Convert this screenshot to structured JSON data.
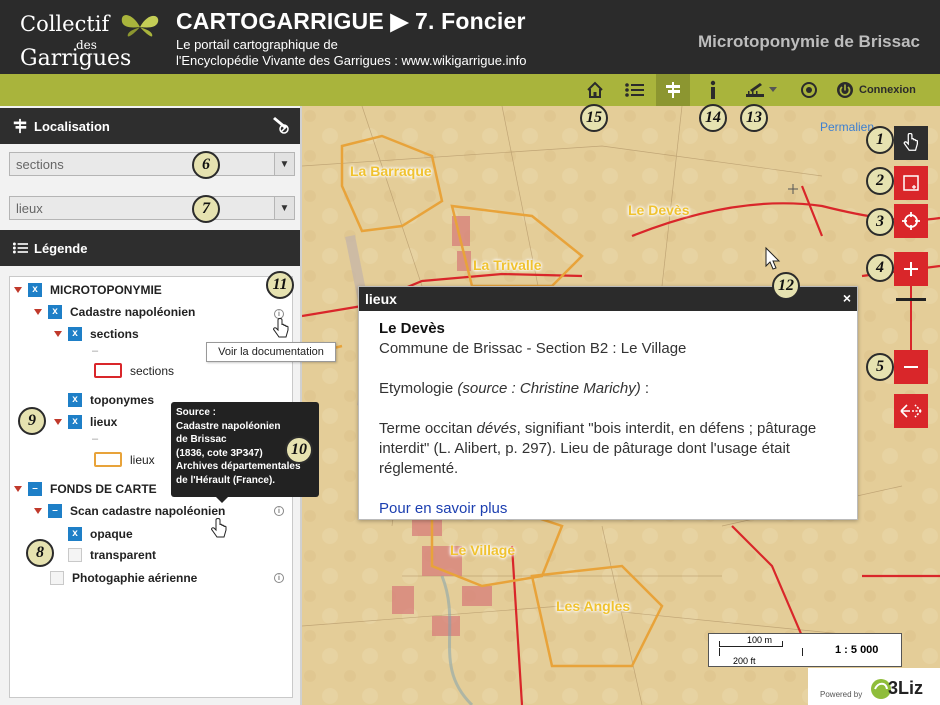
{
  "header": {
    "logo": {
      "line1": "Collectif",
      "line2": "des",
      "line3": "Garrigues"
    },
    "app_title": "CARTOGARRIGUE  ▶  7. Foncier",
    "subtitle_line1": "Le portail cartographique de",
    "subtitle_line2": "l'Encyclopédie Vivante des Garrigues : www.wikigarrigue.info",
    "project_name": "Microtoponymie de Brissac"
  },
  "toolbar": {
    "connexion_label": "Connexion",
    "buttons": [
      "home-icon",
      "layers-list-icon",
      "location-sign-icon",
      "info-icon",
      "measure-icon",
      "target-icon",
      "power-icon"
    ]
  },
  "sidebar": {
    "localisation": {
      "title": "Localisation",
      "select_sections": "sections",
      "select_lieux": "lieux"
    },
    "legende": {
      "title": "Légende",
      "items": {
        "microtoponymie": "MICROTOPONYMIE",
        "cadastre": "Cadastre napoléonien",
        "sections": "sections",
        "sections_dash": "–",
        "sections_symbol": "sections",
        "toponymes": "toponymes",
        "lieux": "lieux",
        "lieux_dash": "–",
        "lieux_symbol": "lieux",
        "fonds": "FONDS DE CARTE",
        "scan": "Scan cadastre napoléonien",
        "opaque": "opaque",
        "transparent": "transparent",
        "photo": "Photogaphie aérienne"
      }
    },
    "tooltip_doc": "Voir la documentation",
    "tooltip_source": [
      "Source :",
      "Cadastre napoléonien",
      "de Brissac",
      "(1836, cote 3P347)",
      "Archives départementales",
      "de l'Hérault (France)."
    ]
  },
  "map": {
    "permalink": "Permalien",
    "labels": {
      "barraque": "La Barraque",
      "deves": "Le Devès",
      "trivalle": "La Trivalle",
      "village": "Le Village",
      "angles": "Les Angles"
    },
    "popup": {
      "title": "lieux",
      "close": "×",
      "name": "Le Devès",
      "commune": "Commune de Brissac - Section B2 : Le Village",
      "etym_prefix": "Etymologie ",
      "etym_source": "(source : Christine Marichy)",
      "etym_suffix": " :",
      "text_pre": "Terme occitan ",
      "text_word": "dévés",
      "text_post": ", signifiant \"bois interdit, en défens ; pâturage interdit\" (L. Alibert, p. 297). Lieu de pâturage dont l'usage était réglementé.",
      "link": "Pour en savoir plus"
    },
    "scale": {
      "metric": "100 m",
      "imperial": "200 ft",
      "ratio": "1 : 5 000"
    },
    "powered": {
      "label": "Powered by",
      "brand": "3Liz"
    }
  },
  "callouts": [
    "1",
    "2",
    "3",
    "4",
    "5",
    "6",
    "7",
    "8",
    "9",
    "10",
    "11",
    "12",
    "13",
    "14",
    "15"
  ],
  "colors": {
    "header_bg": "#2b2b2b",
    "toolbar": "#a9b43c",
    "accent_red": "#d9262a",
    "checkbox_blue": "#1e7fc7",
    "label_yellow": "#f0c230",
    "section_red": "#d9262a",
    "lieux_orange": "#e8a33a"
  }
}
